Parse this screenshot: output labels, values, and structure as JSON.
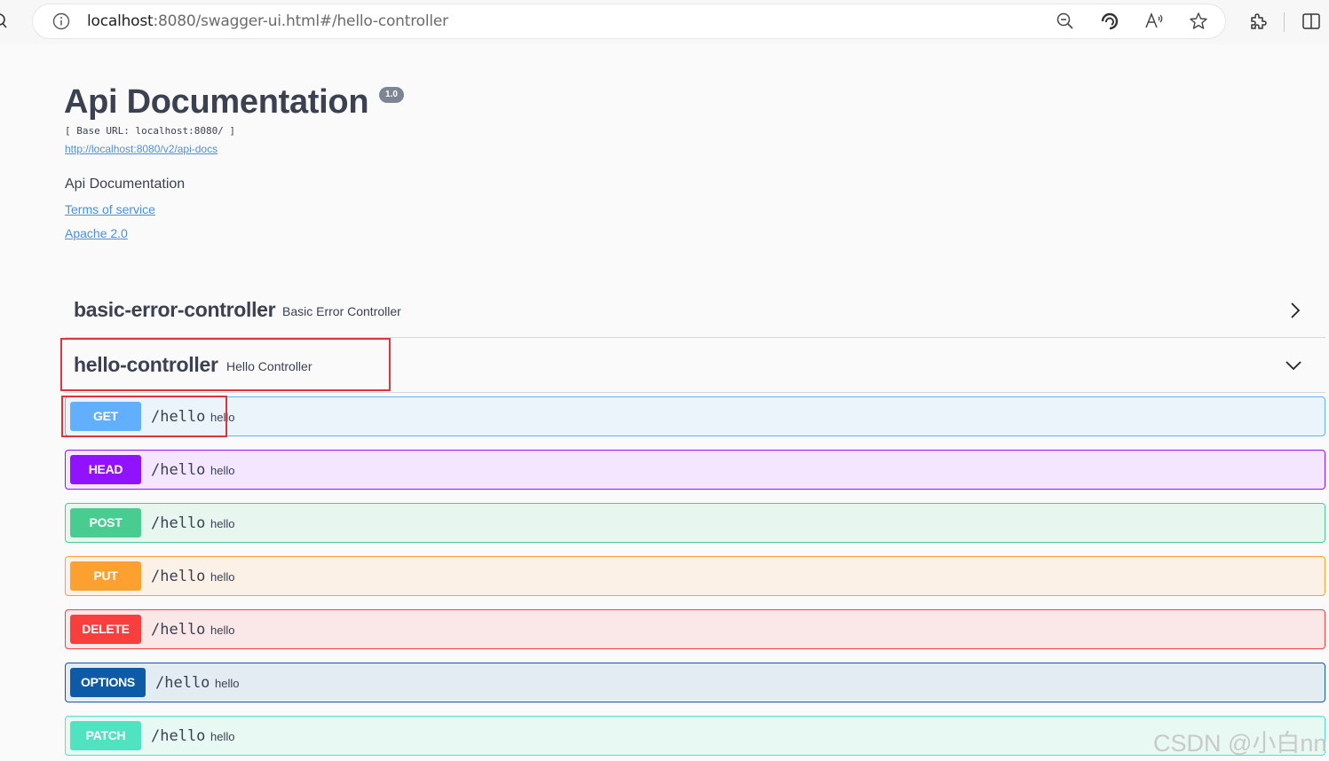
{
  "browser": {
    "url_host": "localhost",
    "url_path": ":8080/swagger-ui.html#/hello-controller",
    "icons": [
      "info-icon",
      "zoom-out-icon",
      "edge-refresh-icon",
      "read-aloud-icon",
      "favorite-star-icon",
      "extensions-icon",
      "split-screen-icon"
    ]
  },
  "info": {
    "title": "Api Documentation",
    "version": "1.0",
    "base_url": "[ Base URL: localhost:8080/ ]",
    "spec_link": "http://localhost:8080/v2/api-docs",
    "description": "Api Documentation",
    "terms_link": "Terms of service",
    "license_link": "Apache 2.0"
  },
  "tags": [
    {
      "name": "basic-error-controller",
      "description": "Basic Error Controller",
      "state": "collapsed"
    },
    {
      "name": "hello-controller",
      "description": "Hello Controller",
      "state": "expanded"
    }
  ],
  "operations": [
    {
      "method": "GET",
      "path": "/hello",
      "summary": "hello",
      "color": "#61affe",
      "bg": "#ebf3fb",
      "border": "#61affe"
    },
    {
      "method": "HEAD",
      "path": "/hello",
      "summary": "hello",
      "color": "#9012fe",
      "bg": "#f3e6fe",
      "border": "#9012fe"
    },
    {
      "method": "POST",
      "path": "/hello",
      "summary": "hello",
      "color": "#49cc90",
      "bg": "#e8f6f0",
      "border": "#49cc90"
    },
    {
      "method": "PUT",
      "path": "/hello",
      "summary": "hello",
      "color": "#fca130",
      "bg": "#fbf1e6",
      "border": "#fca130"
    },
    {
      "method": "DELETE",
      "path": "/hello",
      "summary": "hello",
      "color": "#f93e3e",
      "bg": "#fae7e7",
      "border": "#f93e3e"
    },
    {
      "method": "OPTIONS",
      "path": "/hello",
      "summary": "hello",
      "color": "#0d5aa7",
      "bg": "#e3ebf3",
      "border": "#0d5aa7"
    },
    {
      "method": "PATCH",
      "path": "/hello",
      "summary": "hello",
      "color": "#50e3c2",
      "bg": "#e8f9f4",
      "border": "#50e3c2"
    }
  ],
  "annotation_color": "#e0343c",
  "watermark": "CSDN @小白nn"
}
